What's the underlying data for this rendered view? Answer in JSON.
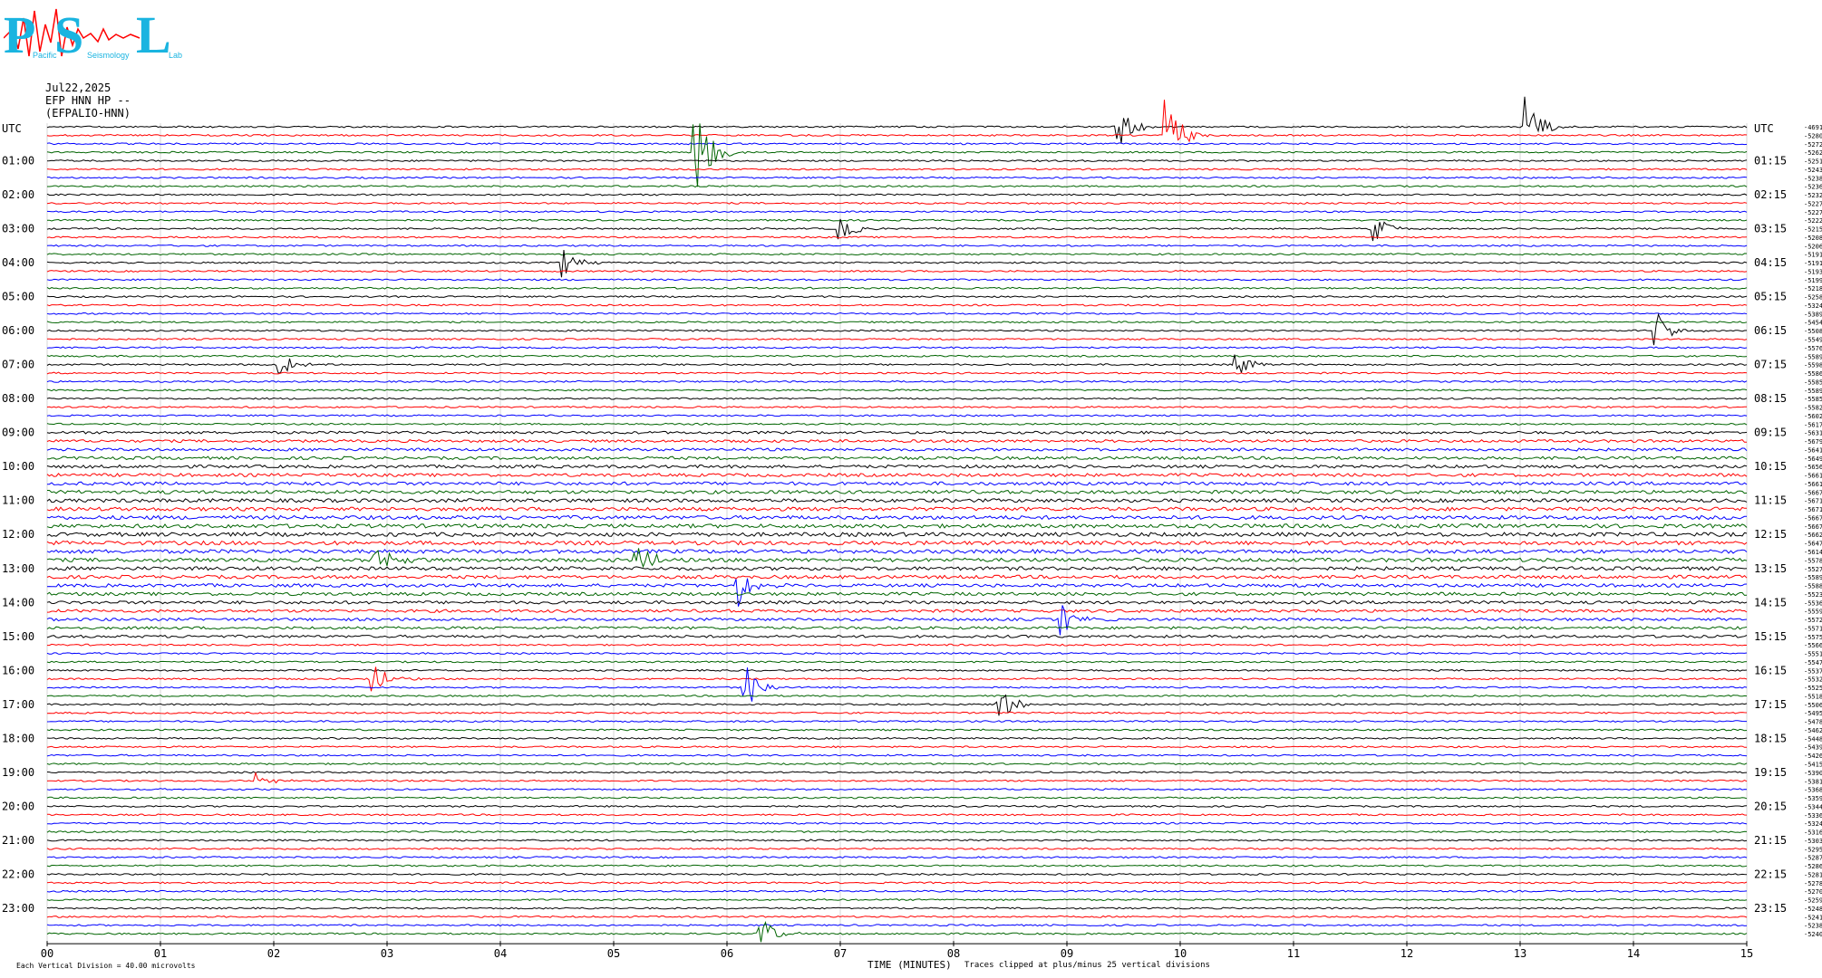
{
  "logo": {
    "letters": [
      "P",
      "S",
      "L"
    ],
    "caption": [
      "Pacific",
      "Seismology",
      "Lab"
    ]
  },
  "header": {
    "date": "Jul22,2025",
    "channel": "EFP HNN HP --",
    "station": "(EFPALIO-HNN)"
  },
  "chart_data": {
    "type": "line",
    "title": "",
    "xlabel": "TIME (MINUTES)",
    "ylabel_left": "UTC",
    "ylabel_right": "UTC",
    "xlim": [
      0,
      15
    ],
    "x_ticks": [
      "00",
      "01",
      "02",
      "03",
      "04",
      "05",
      "06",
      "07",
      "08",
      "09",
      "10",
      "11",
      "12",
      "13",
      "14",
      "15"
    ],
    "left_time_labels": [
      "01:00",
      "02:00",
      "03:00",
      "04:00",
      "05:00",
      "06:00",
      "07:00",
      "08:00",
      "09:00",
      "10:00",
      "11:00",
      "12:00",
      "13:00",
      "14:00",
      "15:00",
      "16:00",
      "17:00",
      "18:00",
      "19:00",
      "20:00",
      "21:00",
      "22:00",
      "23:00"
    ],
    "right_time_labels": [
      "01:15",
      "02:15",
      "03:15",
      "04:15",
      "05:15",
      "06:15",
      "07:15",
      "08:15",
      "09:15",
      "10:15",
      "11:15",
      "12:15",
      "13:15",
      "14:15",
      "15:15",
      "16:15",
      "17:15",
      "18:15",
      "19:15",
      "20:15",
      "21:15",
      "22:15",
      "23:15"
    ],
    "trace_count": 96,
    "minutes_per_trace": 15,
    "trace_colors": [
      "#000000",
      "#ff0000",
      "#0000ff",
      "#006400"
    ],
    "trace_offsets": [
      "-4691",
      "-5280",
      "-5272",
      "-5262",
      "-5251",
      "-5243",
      "-5238",
      "-5236",
      "-5232",
      "-5227",
      "-5227",
      "-5222",
      "-5215",
      "-5208",
      "-5206",
      "-5191",
      "-5191",
      "-5193",
      "-5199",
      "-5218",
      "-5258",
      "-5324",
      "-5389",
      "-5454",
      "-5508",
      "-5549",
      "-5576",
      "-5589",
      "-5598",
      "-5586",
      "-5585",
      "-5589",
      "-5585",
      "-5582",
      "-5602",
      "-5617",
      "-5631",
      "-5679",
      "-5641",
      "-5649",
      "-5656",
      "-5661",
      "-5661",
      "-5667",
      "-5671",
      "-5671",
      "-5667",
      "-5667",
      "-5662",
      "-5647",
      "-5614",
      "-5578",
      "-5527",
      "-5589",
      "-5588",
      "-5523",
      "-5536",
      "-5559",
      "-5572",
      "-5571",
      "-5575",
      "-5566",
      "-5551",
      "-5547",
      "-5537",
      "-5532",
      "-5525",
      "-5518",
      "-5506",
      "-5495",
      "-5478",
      "-5462",
      "-5448",
      "-5439",
      "-5426",
      "-5415",
      "-5390",
      "-5381",
      "-5368",
      "-5359",
      "-5344",
      "-5336",
      "-5324",
      "-5316",
      "-5303",
      "-5295",
      "-5287",
      "-5286",
      "-5281",
      "-5278",
      "-5270",
      "-5259",
      "-5248",
      "-5241",
      "-5238",
      "-5240"
    ],
    "events": [
      {
        "trace": 3,
        "minute": 5.72,
        "amplitude": 14
      },
      {
        "trace": 0,
        "minute": 9.45,
        "amplitude": 6
      },
      {
        "trace": 1,
        "minute": 9.88,
        "amplitude": 9
      },
      {
        "trace": 0,
        "minute": 13.05,
        "amplitude": 8
      },
      {
        "trace": 12,
        "minute": 7.0,
        "amplitude": 3
      },
      {
        "trace": 12,
        "minute": 11.7,
        "amplitude": 4
      },
      {
        "trace": 16,
        "minute": 4.55,
        "amplitude": 4
      },
      {
        "trace": 24,
        "minute": 14.2,
        "amplitude": 5
      },
      {
        "trace": 28,
        "minute": 2.05,
        "amplitude": 3
      },
      {
        "trace": 28,
        "minute": 10.5,
        "amplitude": 3
      },
      {
        "trace": 51,
        "minute": 2.9,
        "amplitude": 5
      },
      {
        "trace": 51,
        "minute": 5.2,
        "amplitude": 5
      },
      {
        "trace": 54,
        "minute": 6.1,
        "amplitude": 5
      },
      {
        "trace": 58,
        "minute": 8.95,
        "amplitude": 4
      },
      {
        "trace": 65,
        "minute": 2.85,
        "amplitude": 5
      },
      {
        "trace": 66,
        "minute": 6.15,
        "amplitude": 7
      },
      {
        "trace": 68,
        "minute": 8.4,
        "amplitude": 4
      },
      {
        "trace": 77,
        "minute": 1.85,
        "amplitude": 2
      },
      {
        "trace": 95,
        "minute": 6.3,
        "amplitude": 4
      }
    ],
    "noisy_bands": [
      {
        "from": 36,
        "to": 60,
        "level": 2.2
      }
    ],
    "grid": true
  },
  "footer": {
    "scale_note": "Each Vertical Division =   40.00 microvolts",
    "xlabel": "TIME (MINUTES)",
    "clip_note": "Traces clipped at plus/minus 25 vertical divisions"
  }
}
